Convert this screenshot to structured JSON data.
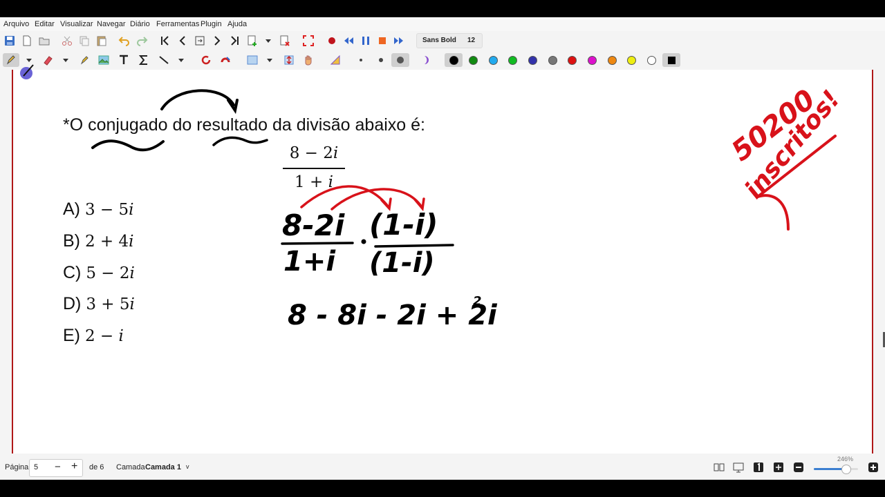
{
  "menu": [
    "Arquivo",
    "Editar",
    "Visualizar",
    "Navegar",
    "Diário",
    "Ferramentas",
    "Plugin",
    "Ajuda"
  ],
  "toolbar": {
    "font_name": "Sans Bold",
    "font_size": "12"
  },
  "pen_colors": [
    "#000000",
    "#118a11",
    "#22aaee",
    "#11bb22",
    "#3333aa",
    "#777777",
    "#dd1111",
    "#dd11cc",
    "#ee8811",
    "#eeee11",
    "#ffffff"
  ],
  "document": {
    "question": "*O conjugado do resultado da divisão abaixo é:",
    "fraction": {
      "numerator": "8 − 2𝑖",
      "denominator": "1 + 𝑖"
    },
    "options": [
      {
        "label": "A)",
        "value": "3 − 5𝑖"
      },
      {
        "label": "B)",
        "value": "2 + 4𝑖"
      },
      {
        "label": "C)",
        "value": "5 − 2𝑖"
      },
      {
        "label": "D)",
        "value": "3 + 5𝑖"
      },
      {
        "label": "E)",
        "value": "2 − 𝑖"
      }
    ],
    "handwriting": {
      "step1_num_left": "8-2i",
      "step1_num_right": "(1-i)",
      "step1_den_left": "1+i",
      "step1_den_right": "(1-i)",
      "step2": "8 - 8i - 2i + 2i",
      "step2_exp": "2",
      "note_count": "50200",
      "note_text": "inscritos!"
    }
  },
  "status": {
    "page_label": "Página",
    "page_value": "5",
    "of_label": "de 6",
    "layer_label": "Camada",
    "layer_value": "Camada 1",
    "zoom": "246%"
  }
}
